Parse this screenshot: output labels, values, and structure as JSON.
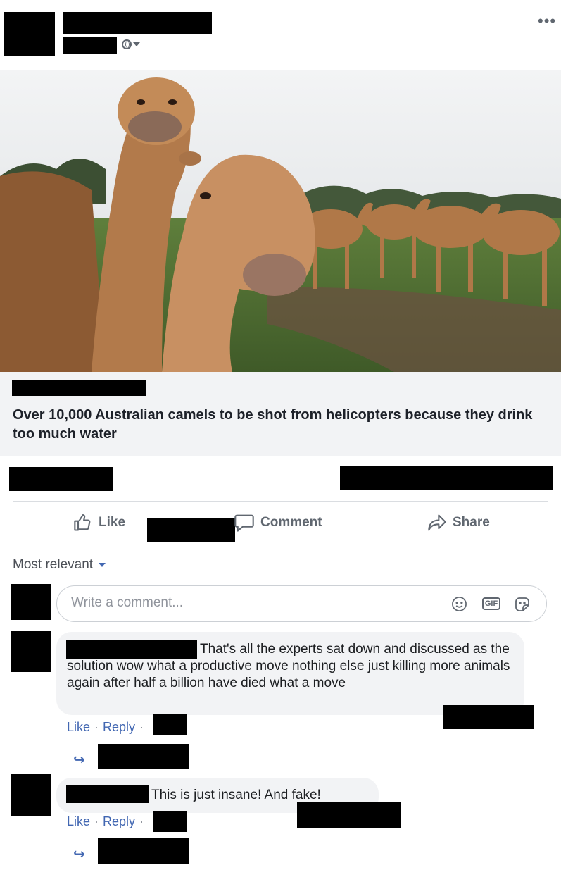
{
  "header": {
    "more_icon": "more-dots-icon",
    "privacy_icon": "globe-icon"
  },
  "link_preview": {
    "image_alt": "camels",
    "headline": "Over 10,000 Australian camels to be shot from helicopters because they drink too much water"
  },
  "actions": {
    "like": "Like",
    "comment": "Comment",
    "share": "Share"
  },
  "comments_section": {
    "sort_label": "Most relevant",
    "composer_placeholder": "Write a comment...",
    "composer_icons": [
      "emoji-icon",
      "gif-icon",
      "sticker-icon"
    ],
    "gif_label": "GIF",
    "comments": [
      {
        "text": "That's all the experts sat down and discussed as the solution wow what a productive move nothing else just killing more animals again after half a billion have died what a move",
        "like": "Like",
        "reply": "Reply",
        "sep": "·"
      },
      {
        "text": "This is just insane! And fake!",
        "like": "Like",
        "reply": "Reply",
        "sep": "·"
      }
    ]
  },
  "colors": {
    "link_blue": "#4267b2",
    "secondary_text": "#606770",
    "bubble_bg": "#f2f3f5"
  }
}
